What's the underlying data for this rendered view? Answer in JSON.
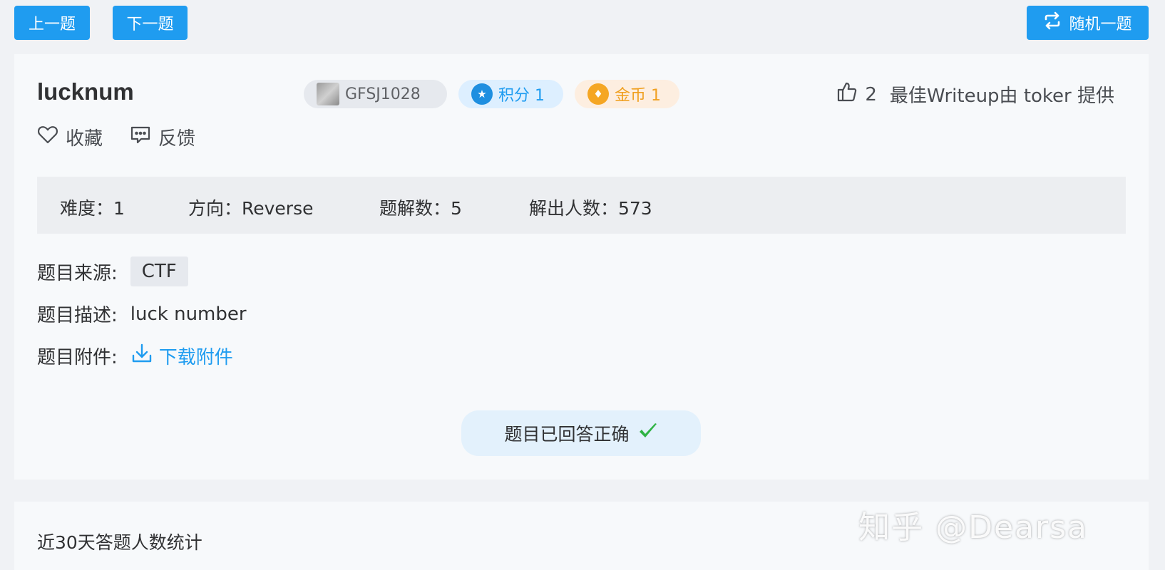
{
  "nav": {
    "prev_label": "上一题",
    "next_label": "下一题",
    "random_label": "随机一题"
  },
  "challenge": {
    "title": "lucknum",
    "id": "GFSJ1028",
    "score": "积分 1",
    "coin": "金币 1",
    "likes": "2",
    "writeup": "最佳Writeup由 toker 提供",
    "favorite_label": "收藏",
    "feedback_label": "反馈"
  },
  "info": {
    "difficulty": "难度：1",
    "direction": "方向：Reverse",
    "solves_writeups": "题解数：5",
    "solvers": "解出人数：573"
  },
  "details": {
    "source_label": "题目来源:",
    "source_value": "CTF",
    "desc_label": "题目描述:",
    "desc_value": "luck number",
    "attach_label": "题目附件:",
    "attach_link": "下载附件"
  },
  "status": {
    "answered": "题目已回答正确"
  },
  "stats": {
    "title": "近30天答题人数统计"
  },
  "watermark": "知乎 @Dearsa",
  "colors": {
    "accent": "#1f9cf0",
    "coin": "#f0a020",
    "success": "#2fb344"
  }
}
